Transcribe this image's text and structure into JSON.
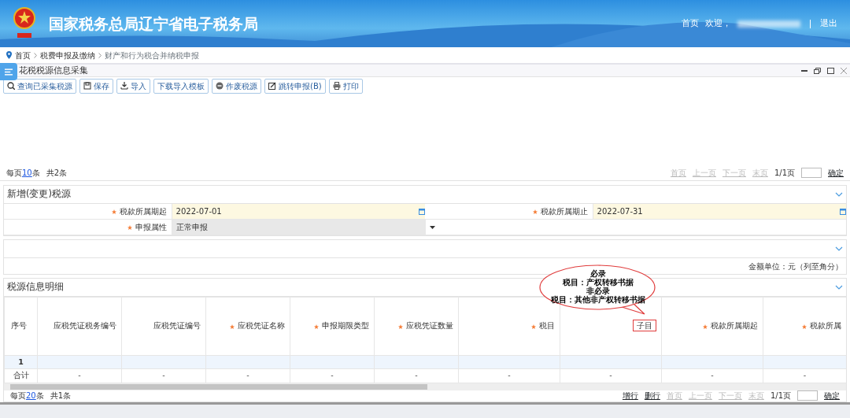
{
  "header": {
    "title": "国家税务总局辽宁省电子税务局",
    "home": "首页",
    "welcome": "欢迎，",
    "logout": "退出"
  },
  "breadcrumb": [
    {
      "label": "首页",
      "current": false
    },
    {
      "label": "税费申报及缴纳",
      "current": false
    },
    {
      "label": "财产和行为税合并纳税申报",
      "current": true
    }
  ],
  "panel": {
    "title": "花税税源信息采集",
    "toolbar": [
      {
        "label": "查询已采集税源",
        "kind": "search"
      },
      {
        "label": "保存",
        "kind": "save"
      },
      {
        "label": "导入",
        "kind": "import"
      },
      {
        "label": "下载导入模板",
        "kind": "plain"
      },
      {
        "label": "作废税源",
        "kind": "cancel"
      },
      {
        "label": "跳转申报(B)",
        "kind": "edit"
      },
      {
        "label": "打印",
        "kind": "print"
      }
    ],
    "pager": {
      "prefix": "每页",
      "size": "10",
      "suffix": "条",
      "total": "共2条",
      "nav": [
        {
          "label": "首页",
          "disabled": true
        },
        {
          "label": "上一页",
          "disabled": true
        },
        {
          "label": "下一页",
          "disabled": true
        },
        {
          "label": "末页",
          "disabled": true
        }
      ],
      "page": "1/1页",
      "confirm": "确定"
    }
  },
  "source_section": {
    "title": "新增(变更)税源",
    "fields": [
      {
        "label": "税款所属期起",
        "required": true,
        "value": "2022-07-01",
        "kind": "date"
      },
      {
        "label": "税款所属期止",
        "required": true,
        "value": "2022-07-31",
        "kind": "date"
      },
      {
        "label": "申报属性",
        "required": true,
        "value": "正常申报",
        "kind": "select"
      }
    ]
  },
  "unit_note": "金额单位：元（列至角分）",
  "detail": {
    "title": "税源信息明细",
    "columns": [
      {
        "label": "序号",
        "required": false
      },
      {
        "label": "应税凭证税务编号",
        "required": false
      },
      {
        "label": "应税凭证编号",
        "required": false
      },
      {
        "label": "应税凭证名称",
        "required": true
      },
      {
        "label": "申报期限类型",
        "required": true
      },
      {
        "label": "应税凭证数量",
        "required": true
      },
      {
        "label": "税目",
        "required": true
      },
      {
        "label": "子目",
        "required": false
      },
      {
        "label": "税款所属期起",
        "required": true
      },
      {
        "label": "税款所属",
        "required": true
      }
    ],
    "rows": [
      [
        "1",
        "",
        "",
        "",
        "",
        "",
        "",
        "",
        "",
        ""
      ],
      [
        "合计",
        "-",
        "-",
        "-",
        "-",
        "-",
        "-",
        "-",
        "-",
        "-"
      ]
    ],
    "callout": [
      "必录",
      "税目：产权转移书据",
      "非必录",
      "税目：其他非产权转移书据"
    ],
    "pager": {
      "prefix": "每页",
      "size": "20",
      "suffix": "条",
      "total": "共1条",
      "actions": [
        "增行",
        "删行"
      ],
      "nav": [
        {
          "label": "首页",
          "disabled": true
        },
        {
          "label": "上一页",
          "disabled": true
        },
        {
          "label": "下一页",
          "disabled": true
        },
        {
          "label": "末页",
          "disabled": true
        }
      ],
      "page": "1/1页",
      "confirm": "确定"
    }
  }
}
